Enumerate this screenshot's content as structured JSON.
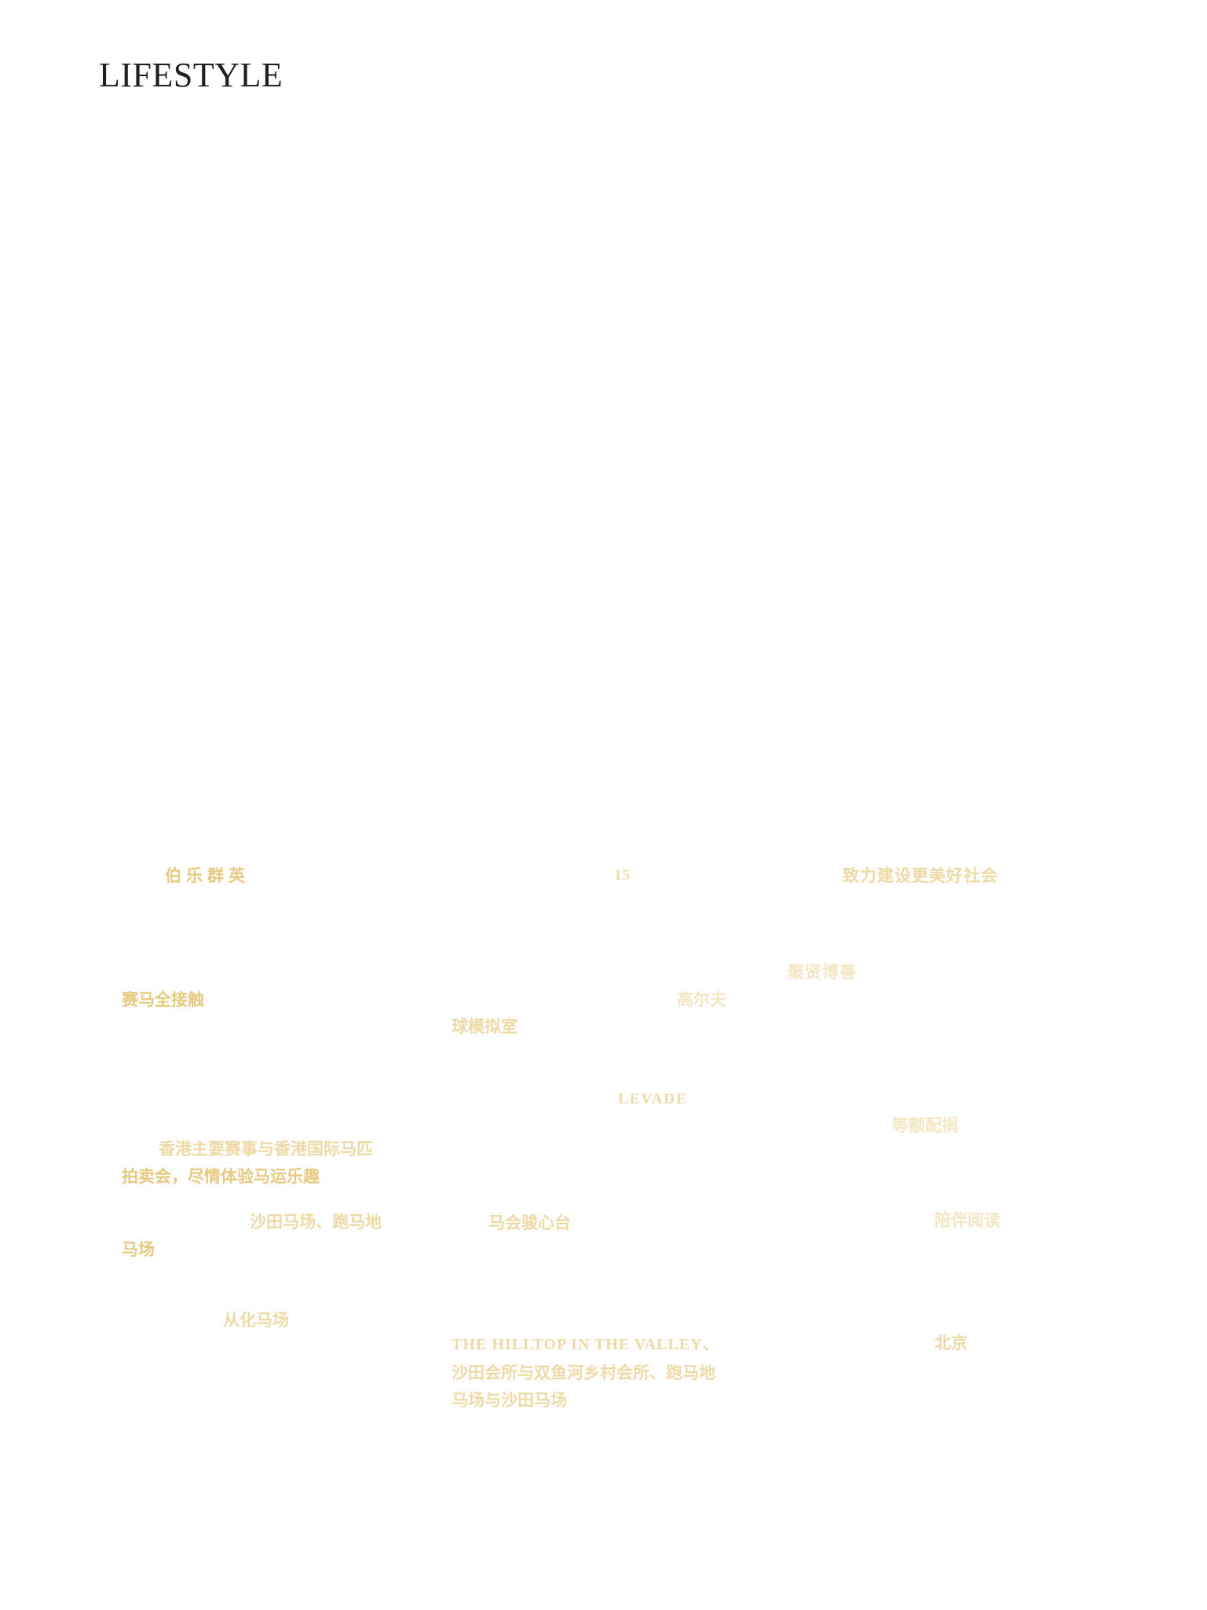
{
  "page": {
    "title": "LIFESTYLE"
  },
  "gold_color": "#e8c97e",
  "columns": {
    "left": {
      "heading": "伯乐群英",
      "subhead": "赛马全接触",
      "para1_line1": "香港主要赛事与香港国际马匹",
      "para1_line2": "拍卖会，尽情体验马运乐趣",
      "para2_line1": "沙田马场、跑马地",
      "para2_line2": "马场",
      "para3": "从化马场"
    },
    "middle": {
      "number": "15",
      "golf": "高尔夫",
      "golf_room": "球模拟室",
      "levade": "LEVADE",
      "jc_heart": "马会骏心台",
      "venues_line1": "THE HILLTOP IN THE VALLEY、",
      "venues_line2": "沙田会所与双鱼河乡村会所、跑马地",
      "venues_line3": "马场与沙田马场"
    },
    "right": {
      "heading": "致力建设更美好社会",
      "subhead": "聚贤博善",
      "matching": "等额配捐",
      "reading": "陪伴阅读",
      "city": "北京"
    }
  }
}
